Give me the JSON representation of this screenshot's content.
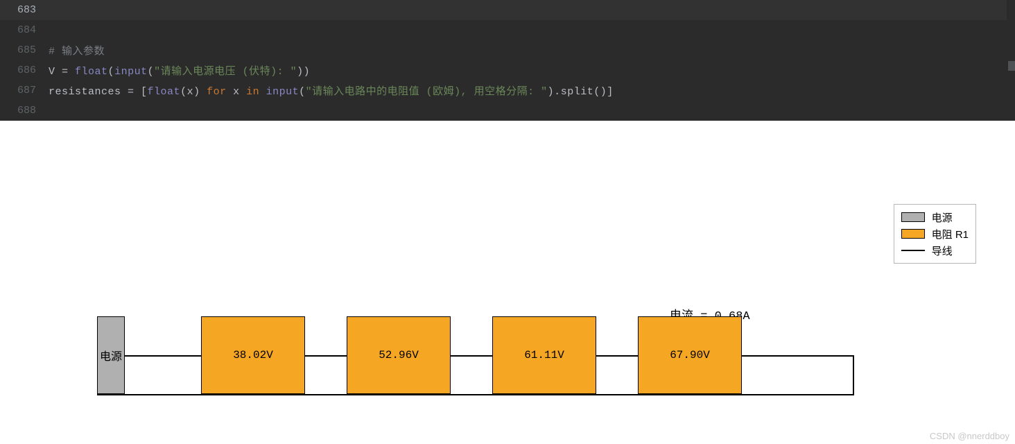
{
  "editor": {
    "lines": [
      {
        "num": "683",
        "current": true,
        "tokens": []
      },
      {
        "num": "684",
        "current": false,
        "tokens": []
      },
      {
        "num": "685",
        "current": false,
        "tokens": [
          {
            "cls": "cmt",
            "t": "# 输入参数"
          }
        ]
      },
      {
        "num": "686",
        "current": false,
        "tokens": [
          {
            "cls": "ident",
            "t": "V "
          },
          {
            "cls": "op",
            "t": "= "
          },
          {
            "cls": "fn",
            "t": "float"
          },
          {
            "cls": "op",
            "t": "("
          },
          {
            "cls": "fn",
            "t": "input"
          },
          {
            "cls": "op",
            "t": "("
          },
          {
            "cls": "str",
            "t": "\"请输入电源电压 (伏特): \""
          },
          {
            "cls": "op",
            "t": "))"
          }
        ]
      },
      {
        "num": "687",
        "current": false,
        "tokens": [
          {
            "cls": "ident",
            "t": "resistances "
          },
          {
            "cls": "op",
            "t": "= ["
          },
          {
            "cls": "fn",
            "t": "float"
          },
          {
            "cls": "op",
            "t": "(x) "
          },
          {
            "cls": "kw",
            "t": "for "
          },
          {
            "cls": "ident",
            "t": "x "
          },
          {
            "cls": "kw",
            "t": "in "
          },
          {
            "cls": "fn",
            "t": "input"
          },
          {
            "cls": "op",
            "t": "("
          },
          {
            "cls": "str",
            "t": "\"请输入电路中的电阻值 (欧姆), 用空格分隔: \""
          },
          {
            "cls": "op",
            "t": ")."
          },
          {
            "cls": "ident",
            "t": "split"
          },
          {
            "cls": "op",
            "t": "()]"
          }
        ]
      },
      {
        "num": "688",
        "current": false,
        "tokens": []
      }
    ]
  },
  "chart_data": {
    "type": "diagram",
    "title": "",
    "current_label": "电流 = 0.68A",
    "current_value": 0.68,
    "source_label": "电源",
    "resistor_voltages": [
      38.02,
      52.96,
      61.11,
      67.9
    ],
    "resistor_labels": [
      "38.02V",
      "52.96V",
      "61.11V",
      "67.90V"
    ],
    "legend": [
      {
        "kind": "grey",
        "label": "电源"
      },
      {
        "kind": "orange",
        "label": "电阻 R1"
      },
      {
        "kind": "line",
        "label": "导线"
      }
    ]
  },
  "watermark": "CSDN @nnerddboy"
}
